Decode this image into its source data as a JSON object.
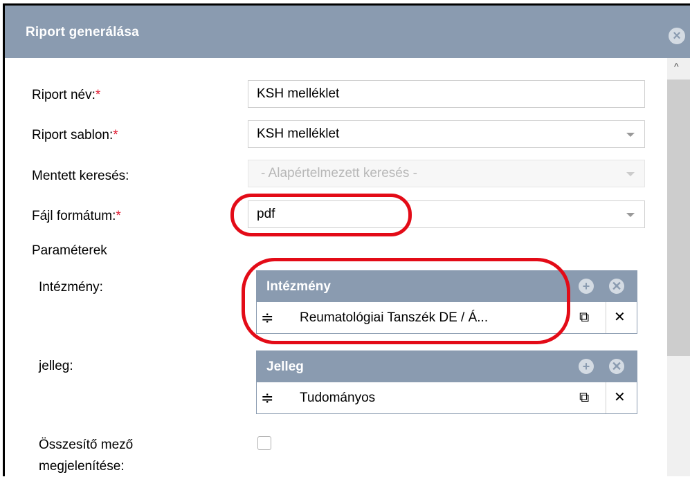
{
  "dialog": {
    "title": "Riport generálása",
    "close_icon": "close-circle-icon"
  },
  "form": {
    "report_name": {
      "label": "Riport név:",
      "required": "*",
      "value": "KSH melléklet"
    },
    "report_template": {
      "label": "Riport sablon:",
      "required": "*",
      "value": "KSH melléklet"
    },
    "saved_search": {
      "label": "Mentett keresés:",
      "value": "- Alapértelmezett keresés -"
    },
    "file_format": {
      "label": "Fájl formátum:",
      "required": "*",
      "value": "pdf"
    },
    "parameters_heading": "Paraméterek",
    "institution": {
      "label": "Intézmény:",
      "panel_title": "Intézmény",
      "items": [
        {
          "text": "Reumatológiai Tanszék DE / Á..."
        }
      ]
    },
    "type": {
      "label": "jelleg:",
      "panel_title": "Jelleg",
      "items": [
        {
          "text": "Tudományos"
        }
      ]
    },
    "summary_field": {
      "label_line1": "Összesítő mező",
      "label_line2": "megjelenítése:",
      "checked": false
    }
  },
  "icons": {
    "drag": "≑",
    "external": "⧉",
    "remove": "✕",
    "add": "+",
    "clear": "✕",
    "scroll_up": "^"
  },
  "colors": {
    "header": "#8a9bb0",
    "required": "#e0192f",
    "annotation": "#e30b17"
  }
}
